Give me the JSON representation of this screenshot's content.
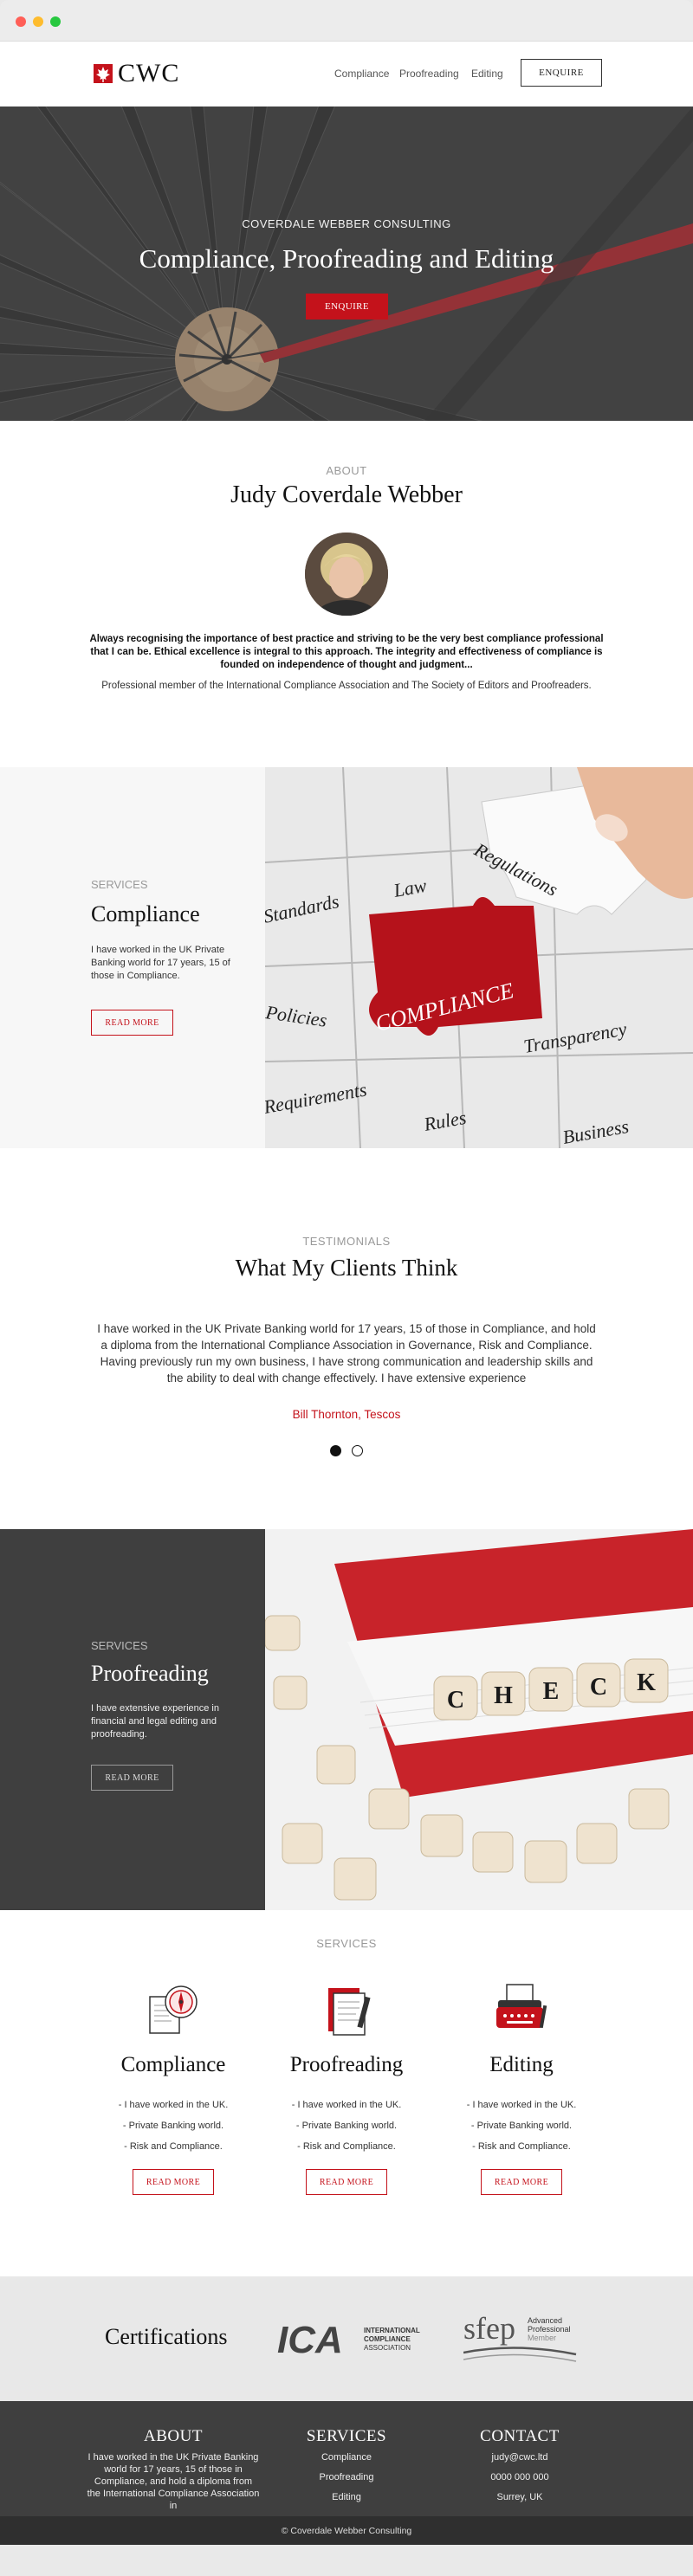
{
  "header": {
    "logo_text": "CWC",
    "nav": [
      "Compliance",
      "Proofreading",
      "Editing"
    ],
    "enquire": "ENQUIRE"
  },
  "hero": {
    "subtitle": "COVERDALE WEBBER CONSULTING",
    "title": "Compliance, Proofreading and Editing",
    "button": "ENQUIRE"
  },
  "about": {
    "label": "ABOUT",
    "name": "Judy Coverdale Webber",
    "bold_text": "Always recognising the importance of best practice and striving to be the very best compliance professional that I can be.  Ethical excellence is integral to this approach. The integrity and effectiveness of compliance is founded on independence of thought and judgment...",
    "membership": "Professional member of the International Compliance Association and The Society of Editors and Proofreaders."
  },
  "service_compliance": {
    "label": "SERVICES",
    "title": "Compliance",
    "text": "I have worked in the UK Private Banking world for 17 years, 15 of those in Compliance.",
    "button": "READ MORE",
    "image_words": [
      "Standards",
      "Law",
      "Regulations",
      "Policies",
      "COMPLIANCE",
      "Transparency",
      "Requirements",
      "Rules",
      "Business"
    ]
  },
  "testimonials": {
    "label": "TESTIMONIALS",
    "title": "What My Clients Think",
    "quote": "I have worked in the UK Private Banking world for 17 years, 15 of those in Compliance, and hold a diploma from the International Compliance Association in Governance, Risk and Compliance. Having previously run my own business, I have strong communication and leadership skills and the ability to deal with change effectively. I have extensive experience",
    "author": "Bill Thornton, Tescos"
  },
  "service_proofreading": {
    "label": "SERVICES",
    "title": "Proofreading",
    "text": "I have extensive experience in financial and legal editing and proofreading.",
    "button": "READ MORE",
    "image_letters": [
      "C",
      "H",
      "E",
      "C",
      "K"
    ]
  },
  "services_grid": {
    "label": "SERVICES",
    "columns": [
      {
        "title": "Compliance",
        "items": [
          "- I have worked in the UK.",
          "- Private Banking world.",
          "- Risk and Compliance."
        ],
        "button": "READ MORE",
        "icon": "compass-icon"
      },
      {
        "title": "Proofreading",
        "items": [
          "- I have worked in the UK.",
          "- Private Banking world.",
          "- Risk and Compliance."
        ],
        "button": "READ MORE",
        "icon": "document-pen-icon"
      },
      {
        "title": "Editing",
        "items": [
          "- I have worked in the UK.",
          "- Private Banking world.",
          "- Risk and Compliance."
        ],
        "button": "READ MORE",
        "icon": "typewriter-icon"
      }
    ]
  },
  "certifications": {
    "title": "Certifications",
    "ica_mark": "ICA",
    "ica_lines": [
      "INTERNATIONAL",
      "COMPLIANCE",
      "ASSOCIATION"
    ],
    "sfep_mark": "sfep",
    "sfep_lines": [
      "Advanced",
      "Professional",
      "Member"
    ]
  },
  "footer": {
    "about_title": "ABOUT",
    "about_text": "I have worked in the UK Private Banking world for 17 years, 15 of those in Compliance, and hold a diploma from the International Compliance Association in",
    "services_title": "SERVICES",
    "services": [
      "Compliance",
      "Proofreading",
      "Editing"
    ],
    "contact_title": "CONTACT",
    "contact": [
      "judy@cwc.ltd",
      "0000 000 000",
      "Surrey, UK"
    ],
    "copyright": "© Coverdale Webber Consulting"
  },
  "colors": {
    "accent": "#c4121b",
    "dark_panel": "#3f3f3f",
    "light_panel": "#f7f7f7"
  }
}
